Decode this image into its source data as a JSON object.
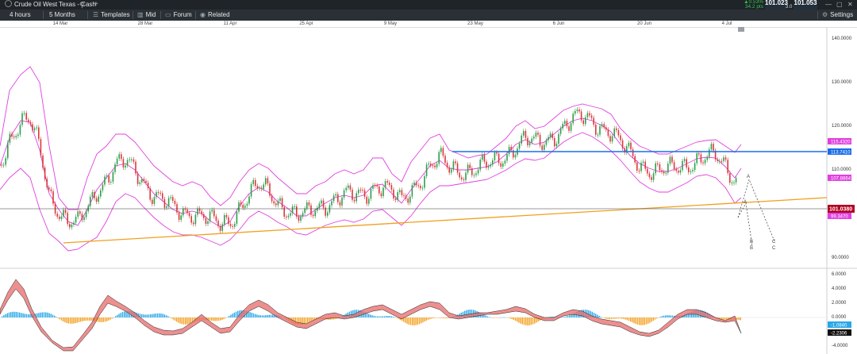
{
  "window": {
    "title": "Crude Oil West Texas - Cash"
  },
  "quote": {
    "change_pct": "▲0.53%",
    "change_pts": "34.2 pts",
    "bid": "101.023",
    "spread": "3.0",
    "ask": "101.053"
  },
  "toolbar": {
    "interval": "4 hours",
    "range": "5 Months",
    "templates": "Templates",
    "mid": "Mid",
    "forum": "Forum",
    "related": "Related",
    "settings": "Settings"
  },
  "date_axis": [
    "14 Mar",
    "28 Mar",
    "11 Apr",
    "25 Apr",
    "9 May",
    "23 May",
    "6 Jun",
    "20 Jun",
    "4 Jul"
  ],
  "price_axis": [
    "140.0000",
    "130.0000",
    "120.0000",
    "110.0000",
    "101.0380",
    "90.0000"
  ],
  "price_tags": {
    "bb_upper": "115.4320",
    "hline_blue": "113.7410",
    "bb_mid": "107.8864",
    "last": "101.0380",
    "bb_lower": "99.3470"
  },
  "macd_axis": [
    "6.0000",
    "4.0000",
    "2.0000",
    "0.0000",
    "-4.0000"
  ],
  "macd_tags": {
    "signal": "-1.0840",
    "macd": "-2.2306"
  },
  "wave_labels": [
    "A",
    "B",
    "A",
    "B",
    "C",
    "C"
  ],
  "colors": {
    "topbar": "#1f2429",
    "toolbar": "#2a3035",
    "bollinger": "#e040e0",
    "trendline": "#f0a020",
    "hline": "#1a6ee8",
    "last_tag": "#b00020",
    "candle_up": "#2e9e4a",
    "candle_down": "#d83a3a",
    "macd_pos": "#29a8e8",
    "macd_neg": "#f4a020"
  }
}
